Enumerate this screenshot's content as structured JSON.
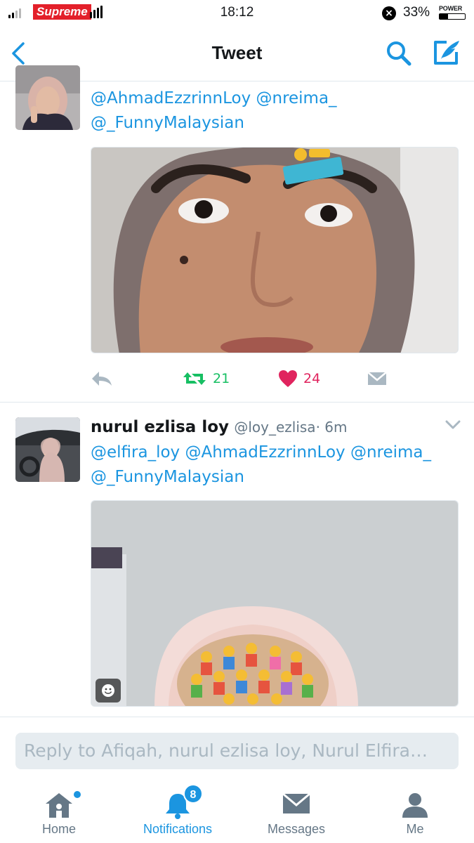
{
  "status_bar": {
    "carrier": "Supreme",
    "time": "18:12",
    "battery_percent": "33%",
    "battery_label": "POWER",
    "battery_level": 0.33
  },
  "nav": {
    "title": "Tweet",
    "back_icon": "chevron-left-icon",
    "search_icon": "search-icon",
    "compose_icon": "compose-icon",
    "accent_color": "#1b95e0"
  },
  "tweets": [
    {
      "text_lines": [
        "@AhmadEzzrinnLoy @nreima_",
        "@_FunnyMalaysian"
      ],
      "media": "selfie of a person in a hijab looking up with a sticker on forehead",
      "actions": {
        "retweets": "21",
        "likes": "24"
      },
      "liked": true,
      "retweet_color": "#17bf63",
      "like_color": "#e0245e"
    },
    {
      "display_name": "nurul ezlisa loy",
      "handle": "@loy_ezlisa",
      "time": "· 6m",
      "text_lines": [
        "@elfira_loy @AhmadEzzrinnLoy @nreima_",
        "@_FunnyMalaysian"
      ],
      "media": "photo of a person in a hijab with face covered by emoji stickers"
    }
  ],
  "reply": {
    "placeholder": "Reply to Afiqah, nurul ezlisa loy, Nurul Elfira…"
  },
  "tabs": [
    {
      "label": "Home",
      "icon": "home-icon",
      "has_dot": true
    },
    {
      "label": "Notifications",
      "icon": "bell-icon",
      "badge": "8",
      "active": true
    },
    {
      "label": "Messages",
      "icon": "envelope-icon"
    },
    {
      "label": "Me",
      "icon": "person-icon"
    }
  ]
}
